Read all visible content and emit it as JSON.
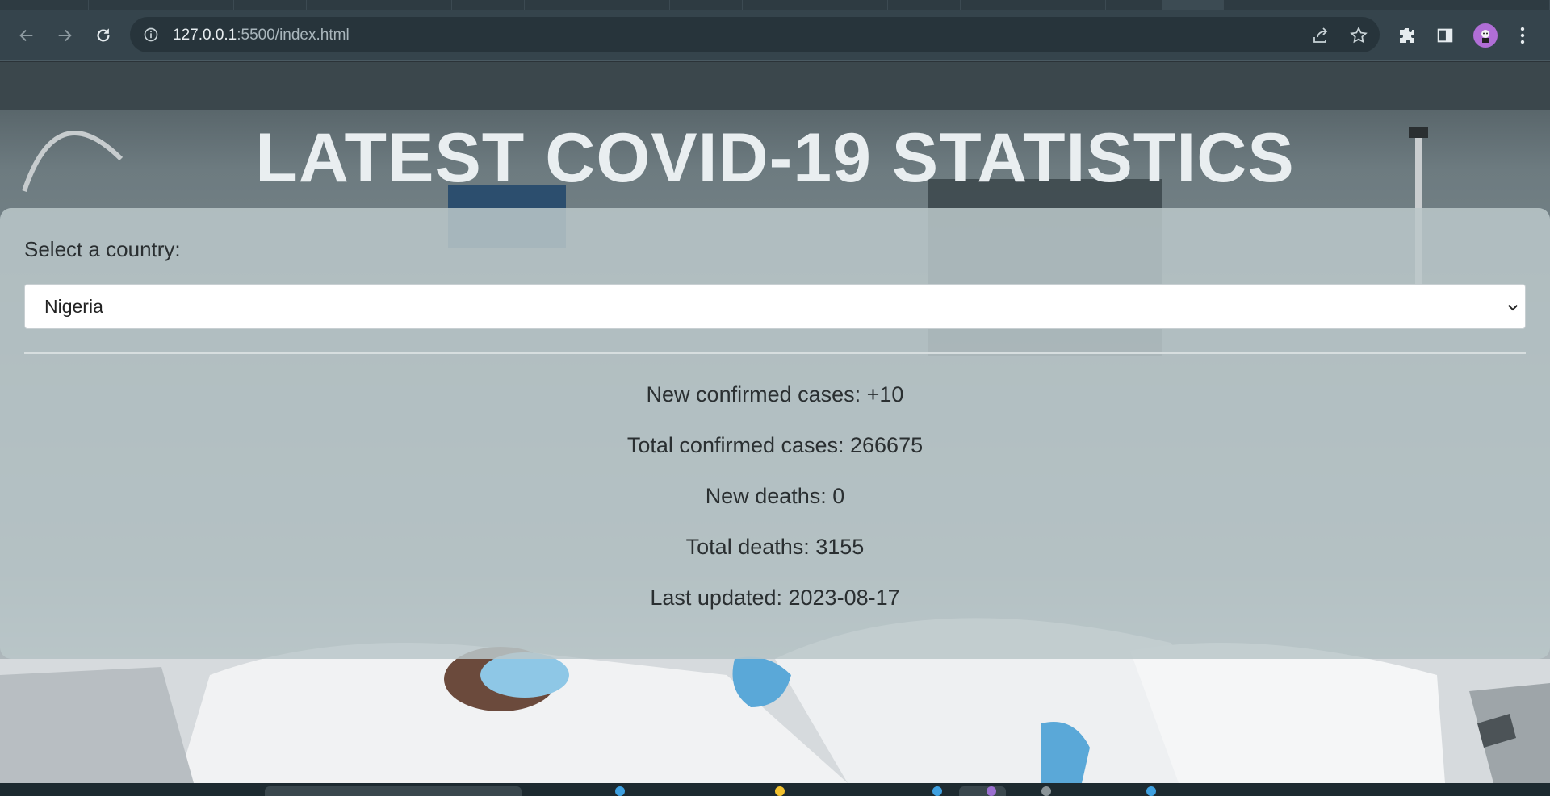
{
  "browser": {
    "url_host": "127.0.0.1",
    "url_path": ":5500/index.html"
  },
  "page": {
    "title": "LATEST COVID-19 STATISTICS",
    "select_label": "Select a country:",
    "selected_country": "Nigeria",
    "stats": [
      "New confirmed cases: +10",
      "Total confirmed cases: 266675",
      "New deaths: 0",
      "Total deaths: 3155",
      "Last updated: 2023-08-17"
    ]
  },
  "colors": {
    "panel": "#bac7ca",
    "title": "#e9eef0",
    "chrome": "#35444c",
    "avatar": "#b06ed6"
  },
  "icons": [
    "back-arrow-icon",
    "forward-arrow-icon",
    "reload-icon",
    "info-icon",
    "share-icon",
    "star-icon",
    "extensions-icon",
    "side-panel-icon",
    "menu-icon",
    "chevron-down-icon"
  ]
}
